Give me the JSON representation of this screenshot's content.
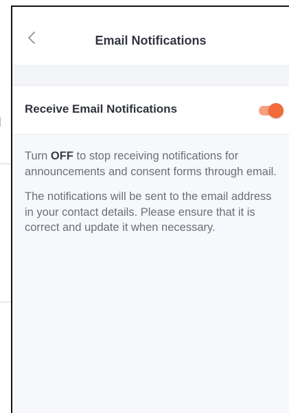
{
  "header": {
    "title": "Email Notifications",
    "back_icon": "chevron-left-icon"
  },
  "setting": {
    "label": "Receive Email Notifications",
    "toggle_on": true,
    "accent_color": "#f26b3a"
  },
  "info": {
    "p1_prefix": "Turn ",
    "p1_bold": "OFF",
    "p1_suffix": " to stop receiving notifications for announcements and consent forms through email.",
    "p2": "The notifications will be sent to the email address in your contact details. Please ensure that it is correct and update it when necessary."
  }
}
